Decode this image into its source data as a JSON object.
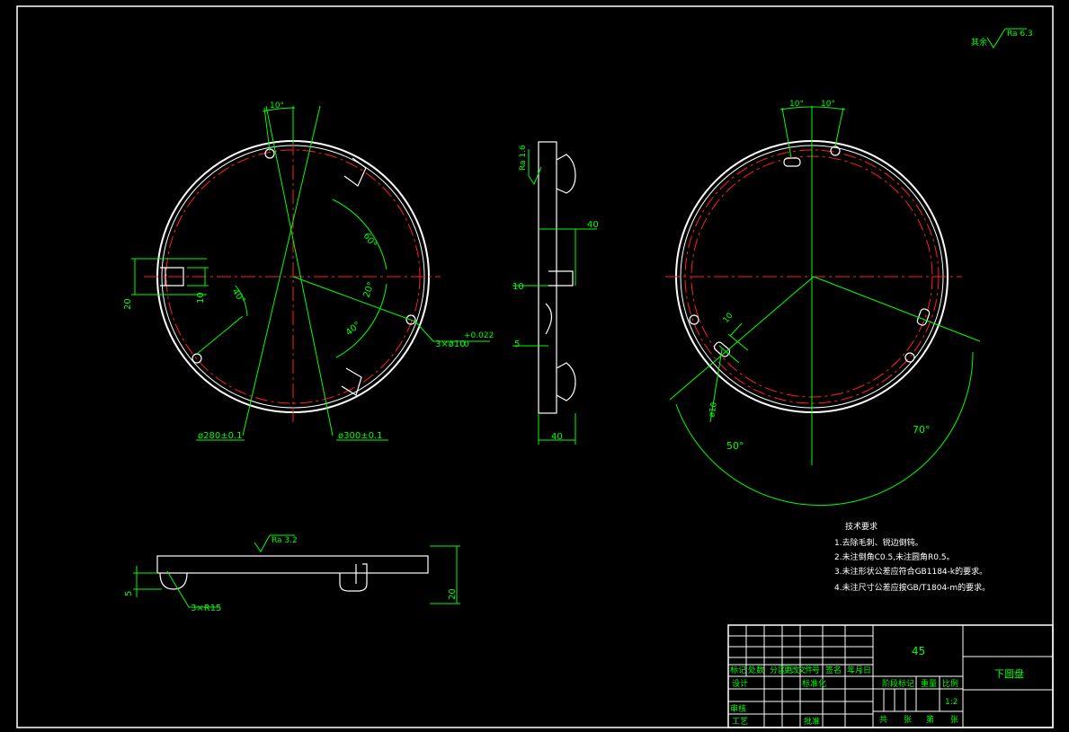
{
  "roughness": {
    "rest_label": "其余",
    "rest_value": "Ra 6.3",
    "side_value": "Ra 1.6",
    "bottom_value": "Ra 3.2"
  },
  "front_view": {
    "angle_top": "10°",
    "angle_a": "60°",
    "angle_b": "20°",
    "angle_c": "40°",
    "angle_left": "40°",
    "dim_20": "20",
    "dim_10": "10",
    "holes": "3×ø10",
    "holes_tol": "+0.022",
    "holes_tol2": "0",
    "d280": "ø280±0.1",
    "d300": "ø300±0.1"
  },
  "side_view": {
    "d40_top": "40",
    "d10": "10",
    "d5": "5",
    "d40_bottom": "40"
  },
  "back_view": {
    "angle_l": "10°",
    "angle_r": "10°",
    "slot_w": "10",
    "slot_d": "ø10",
    "angle_50": "50°",
    "angle_70": "70°"
  },
  "bottom_view": {
    "dim_5": "5",
    "dim_20": "20",
    "radius": "3×R15"
  },
  "tech": {
    "title": "技术要求",
    "lines": [
      "1.去除毛刺、锐边倒钝。",
      "2.未注倒角C0.5,未注圆角R0.5。",
      "3.未注形状公差应符合GB1184-k的要求。",
      "4.未注尺寸公差应按GB/T1804-m的要求。"
    ]
  },
  "title_block": {
    "material": "45",
    "part_name": "下圆盘",
    "row_labels": [
      "标记",
      "处数",
      "分区",
      "更改文件号",
      "签名",
      "年、月、日"
    ],
    "designer": "设计",
    "standardize": "标准化",
    "stage_mark": "阶段标记",
    "weight": "重量",
    "scale_label": "比例",
    "scale": "1:2",
    "review": "审核",
    "process": "工艺",
    "approve": "批准",
    "sheets": [
      "共",
      "张",
      "第",
      "张"
    ]
  }
}
